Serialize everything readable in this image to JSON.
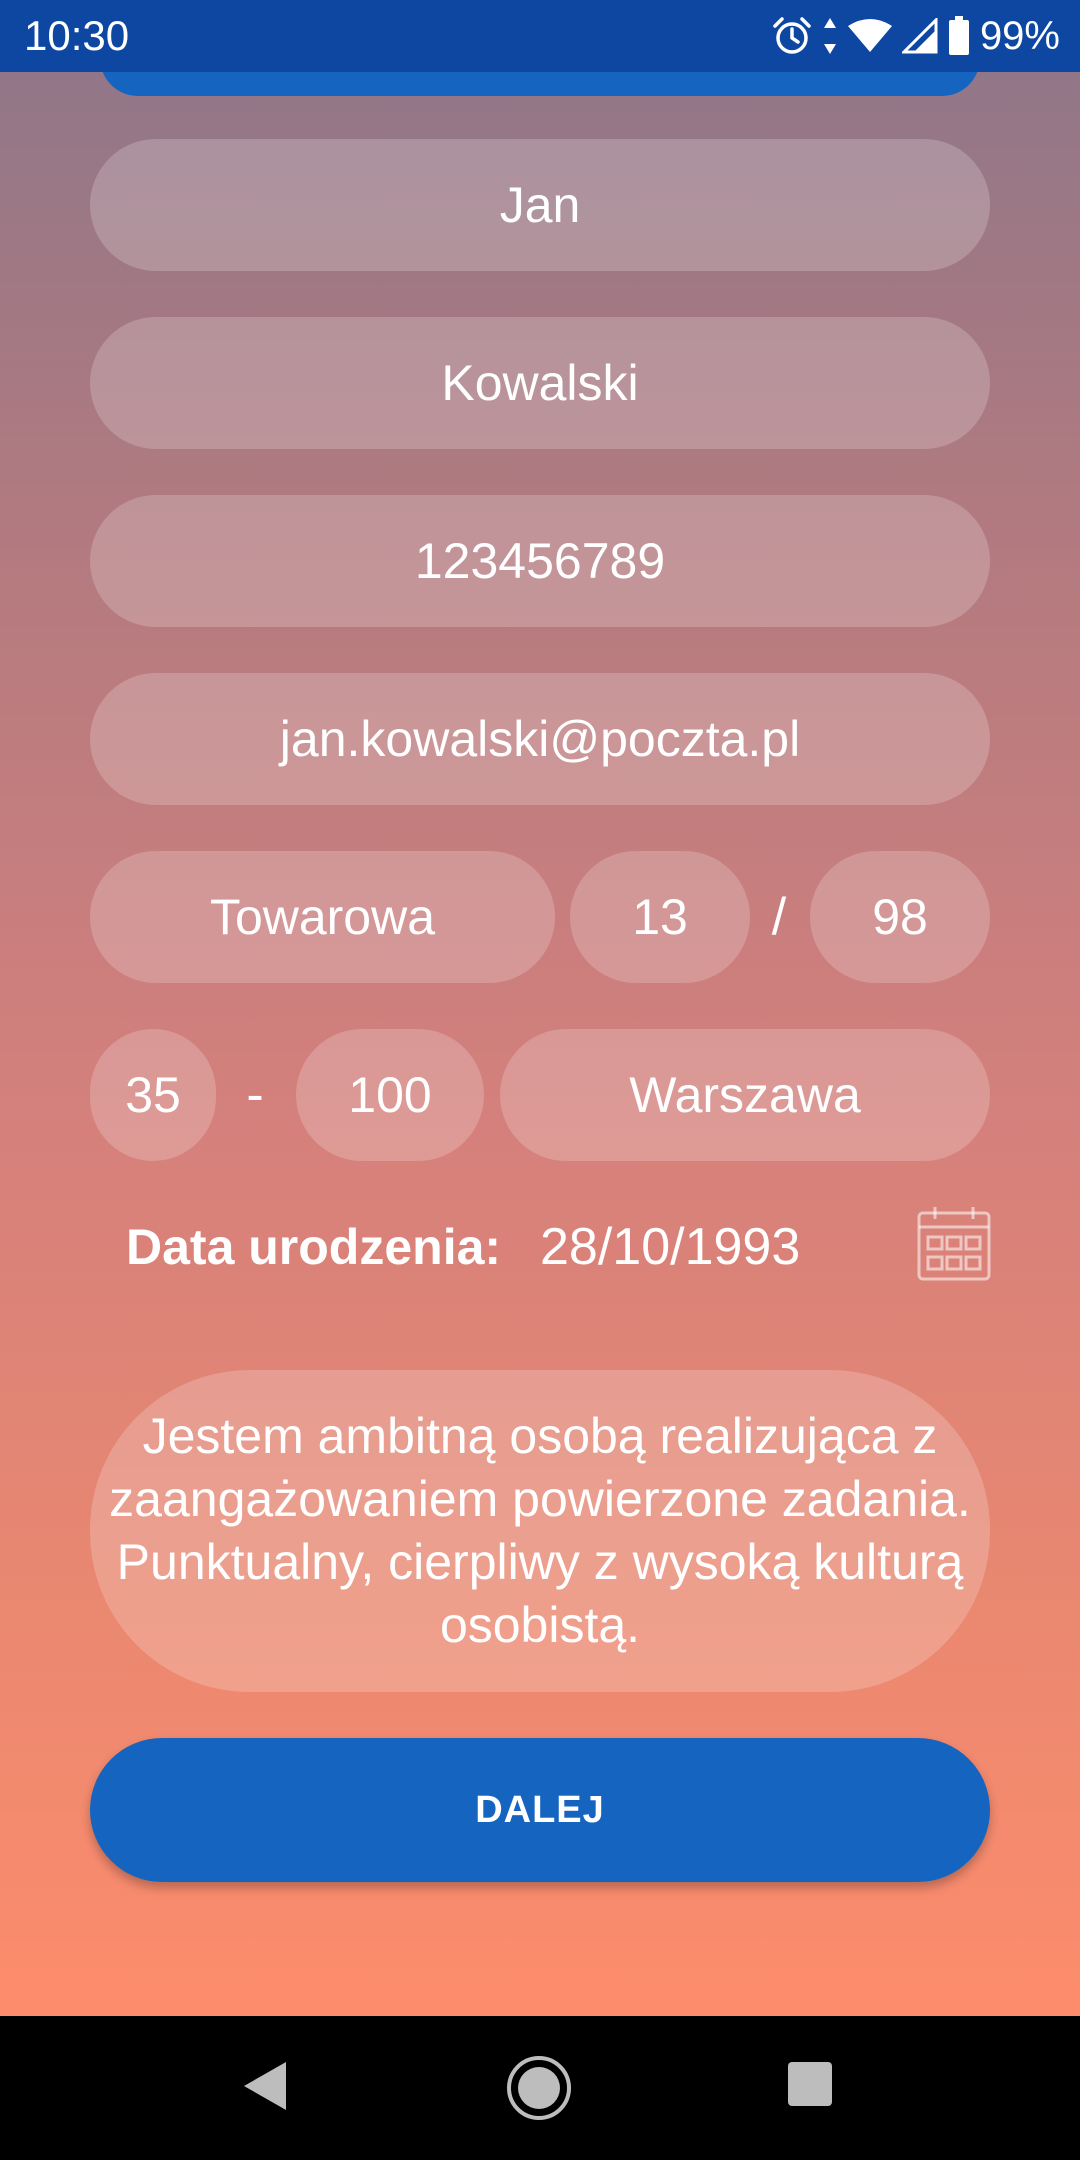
{
  "status_bar": {
    "time": "10:30",
    "battery_percent": "99%",
    "icons": [
      "alarm-icon",
      "data-arrows-icon",
      "wifi-icon",
      "cell-signal-icon",
      "battery-icon"
    ]
  },
  "form": {
    "first_name": "Jan",
    "last_name": "Kowalski",
    "phone": "123456789",
    "email": "jan.kowalski@poczta.pl",
    "street": "Towarowa",
    "building_number": "13",
    "address_separator": "/",
    "apartment_number": "98",
    "postal_code_part1": "35",
    "postal_separator": "-",
    "postal_code_part2": "100",
    "city": "Warszawa",
    "birth_date_label": "Data urodzenia:",
    "birth_date_value": "28/10/1993",
    "bio": "Jestem ambitną osobą realizująca z zaangażowaniem powierzone zadania. Punktualny, cierpliwy z wysoką kulturą osobistą."
  },
  "actions": {
    "next_label": "DALEJ"
  },
  "colors": {
    "primary": "#1565c0",
    "status_bar": "#0d47a1",
    "gradient_top": "#8d7689",
    "gradient_bottom": "#fd8c6c"
  },
  "nav_bar": {
    "icons": [
      "back-icon",
      "home-icon",
      "recents-icon"
    ]
  }
}
